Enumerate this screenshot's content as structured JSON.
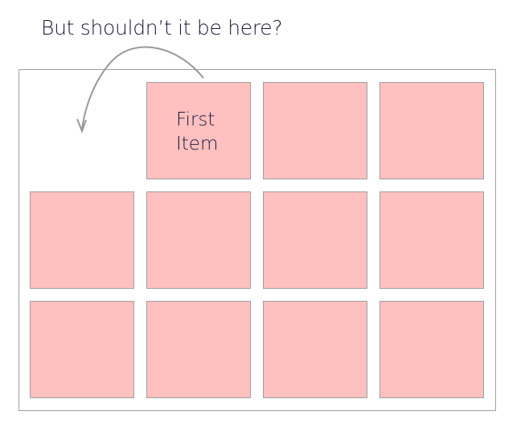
{
  "caption": "But shouldn’t it be here?",
  "grid": {
    "columns": 4,
    "rows": 3,
    "empty_cell": {
      "row": 1,
      "col": 1
    },
    "items": [
      {
        "label_lines": [
          "First",
          "Item"
        ],
        "row": 1,
        "col": 2
      },
      {
        "label_lines": [],
        "row": 1,
        "col": 3
      },
      {
        "label_lines": [],
        "row": 1,
        "col": 4
      },
      {
        "label_lines": [],
        "row": 2,
        "col": 1
      },
      {
        "label_lines": [],
        "row": 2,
        "col": 2
      },
      {
        "label_lines": [],
        "row": 2,
        "col": 3
      },
      {
        "label_lines": [],
        "row": 2,
        "col": 4
      },
      {
        "label_lines": [],
        "row": 3,
        "col": 1
      },
      {
        "label_lines": [],
        "row": 3,
        "col": 2
      },
      {
        "label_lines": [],
        "row": 3,
        "col": 3
      },
      {
        "label_lines": [],
        "row": 3,
        "col": 4
      }
    ]
  },
  "arrow": {
    "from": "first-item",
    "to": "empty-cell",
    "meaning": "suggests first item should occupy the empty top-left cell"
  },
  "colors": {
    "item_fill": "#ffc0c0",
    "item_border": "#a0a0a0",
    "container_border": "#9e9e9e",
    "arrow": "#999999",
    "text": "#1a1a3a"
  }
}
